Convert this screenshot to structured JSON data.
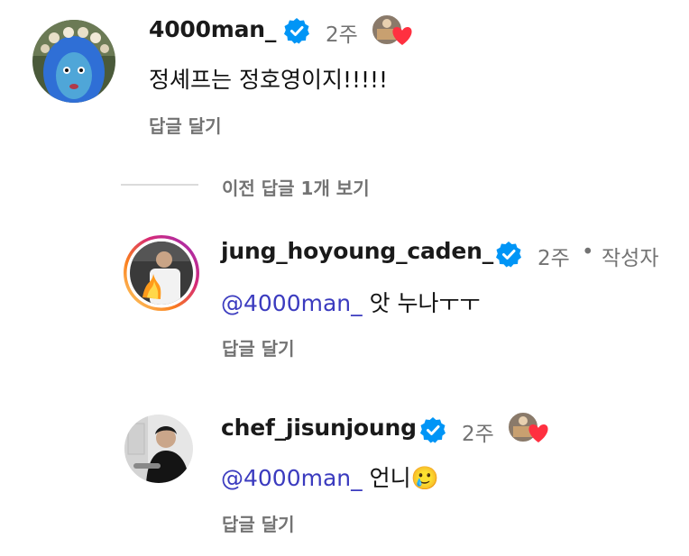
{
  "comments": [
    {
      "username": "4000man_",
      "verified": true,
      "time": "2주",
      "liked_by_author": true,
      "text": "정셰프는 정호영이지!!!!!",
      "reply_label": "답글 달기",
      "avatar_icon": "avatar-blue-face"
    }
  ],
  "replies_toggle": {
    "label": "이전 답글 1개 보기"
  },
  "replies": [
    {
      "username": "jung_hoyoung_caden_",
      "verified": true,
      "time": "2주",
      "separator": "•",
      "author_badge": "작성자",
      "mention": "@4000man_",
      "text": "앗 누나ㅜㅜ",
      "reply_label": "답글 달기",
      "has_story_ring": true
    },
    {
      "username": "chef_jisunjoung",
      "verified": true,
      "time": "2주",
      "liked_by_author": true,
      "mention": "@4000man_",
      "text": "언니🥲",
      "reply_label": "답글 달기"
    }
  ],
  "colors": {
    "verified_blue": "#0095f6",
    "mention": "#3b3bbf",
    "muted": "#737373",
    "heart": "#ff3040"
  }
}
